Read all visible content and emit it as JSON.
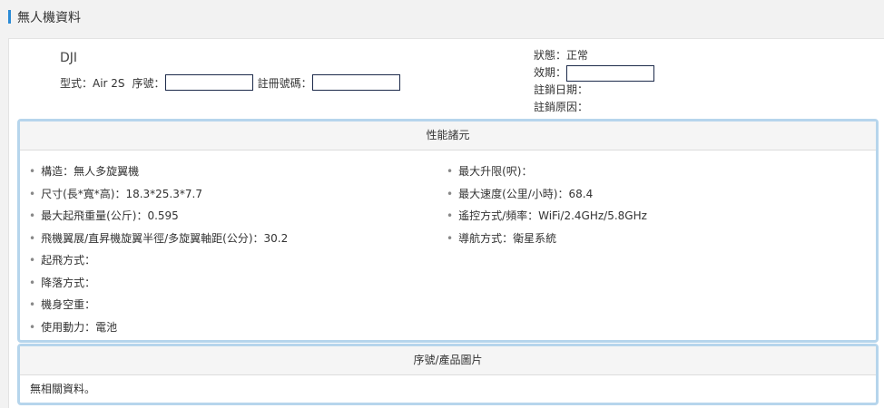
{
  "page_title": "無人機資料",
  "drone": {
    "brand": "DJI",
    "model_label": "型式：Air 2S",
    "serial_label": "序號：",
    "serial_value": "",
    "registration_label": "註冊號碼：",
    "registration_value": ""
  },
  "status": {
    "state": "狀態：正常",
    "validity_label": "效期：",
    "validity_value": "",
    "cancel_date": "註銷日期：",
    "cancel_reason": "註銷原因："
  },
  "performance": {
    "heading": "性能諸元",
    "left": [
      "構造：無人多旋翼機",
      "尺寸(長*寬*高)：18.3*25.3*7.7",
      "最大起飛重量(公斤)：0.595",
      "飛機翼展/直昇機旋翼半徑/多旋翼軸距(公分)：30.2",
      "起飛方式：",
      "降落方式：",
      "機身空重：",
      "使用動力：電池"
    ],
    "right": [
      "最大升限(呎)：",
      "最大速度(公里/小時)：68.4",
      "遙控方式/頻率：WiFi/2.4GHz/5.8GHz",
      "導航方式：衛星系統"
    ]
  },
  "images": {
    "heading": "序號/產品圖片",
    "empty_text": "無相關資料。"
  },
  "colors": {
    "accent": "#2a8bd6",
    "panel_border": "#b6d5ec"
  }
}
